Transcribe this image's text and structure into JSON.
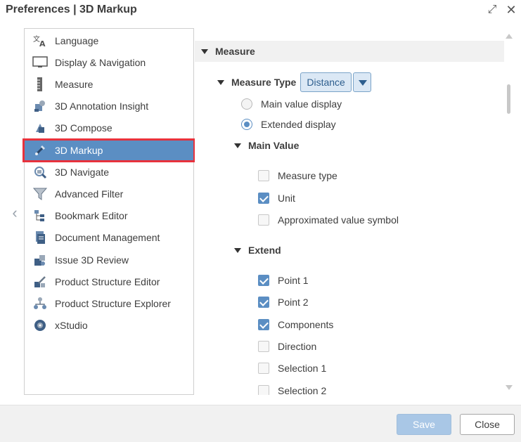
{
  "window": {
    "title": "Preferences | 3D Markup"
  },
  "sidebar": {
    "items": [
      {
        "label": "Language",
        "icon": "language-icon"
      },
      {
        "label": "Display & Navigation",
        "icon": "monitor-icon"
      },
      {
        "label": "Measure",
        "icon": "ruler-icon"
      },
      {
        "label": "3D Annotation Insight",
        "icon": "annotation-insight-icon"
      },
      {
        "label": "3D Compose",
        "icon": "compose-icon"
      },
      {
        "label": "3D Markup",
        "icon": "markup-icon",
        "selected": true
      },
      {
        "label": "3D Navigate",
        "icon": "navigate-icon"
      },
      {
        "label": "Advanced Filter",
        "icon": "filter-icon"
      },
      {
        "label": "Bookmark Editor",
        "icon": "bookmark-editor-icon"
      },
      {
        "label": "Document Management",
        "icon": "document-icon"
      },
      {
        "label": "Issue 3D Review",
        "icon": "issue-review-icon"
      },
      {
        "label": "Product Structure Editor",
        "icon": "structure-editor-icon"
      },
      {
        "label": "Product Structure Explorer",
        "icon": "structure-explorer-icon"
      },
      {
        "label": "xStudio",
        "icon": "xstudio-icon"
      }
    ]
  },
  "content": {
    "section_title": "Measure",
    "measure_type": {
      "label": "Measure Type",
      "selected": "Distance"
    },
    "display_options": [
      {
        "label": "Main value display",
        "checked": false
      },
      {
        "label": "Extended display",
        "checked": true
      }
    ],
    "main_value": {
      "title": "Main Value",
      "options": [
        {
          "label": "Measure type",
          "checked": false
        },
        {
          "label": "Unit",
          "checked": true
        },
        {
          "label": "Approximated value symbol",
          "checked": false
        }
      ]
    },
    "extend": {
      "title": "Extend",
      "options": [
        {
          "label": "Point 1",
          "checked": true
        },
        {
          "label": "Point 2",
          "checked": true
        },
        {
          "label": "Components",
          "checked": true
        },
        {
          "label": "Direction",
          "checked": false
        },
        {
          "label": "Selection 1",
          "checked": false
        },
        {
          "label": "Selection 2",
          "checked": false
        }
      ]
    }
  },
  "footer": {
    "save_label": "Save",
    "close_label": "Close"
  },
  "colors": {
    "accent": "#5b8ec3",
    "highlight": "#e8323c"
  }
}
